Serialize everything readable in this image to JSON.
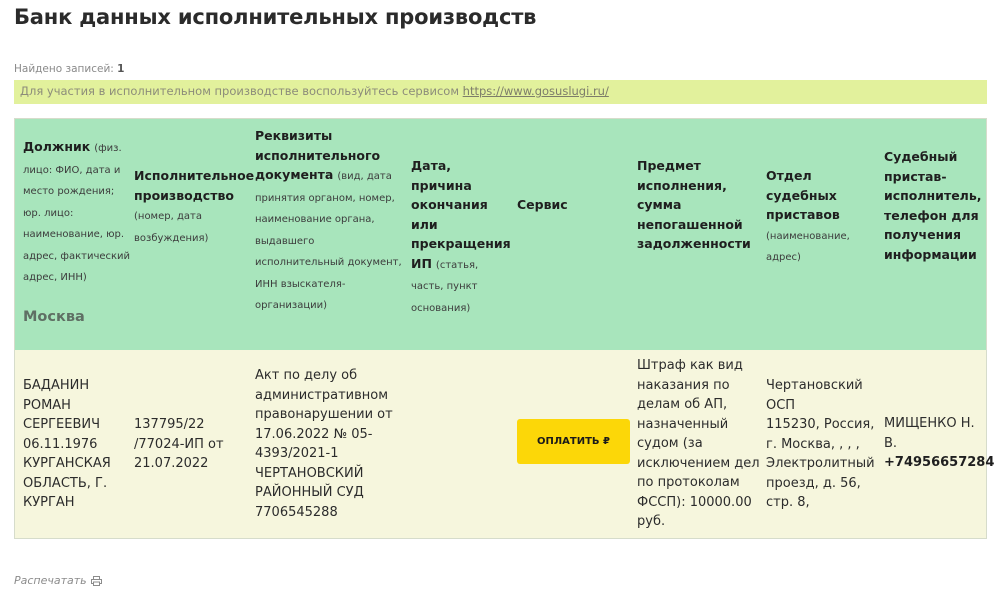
{
  "page": {
    "title": "Банк данных исполнительных производств"
  },
  "summary": {
    "found_label": "Найдено записей:",
    "found_count": "1"
  },
  "notice": {
    "text": "Для участия в исполнительном производстве воспользуйтесь сервисом",
    "link": "https://www.gosuslugi.ru/"
  },
  "table": {
    "columns": [
      {
        "title": "Должник",
        "sub": "(физ. лицо: ФИО, дата и место рождения; юр. лицо: наименование, юр. адрес, фактический адрес, ИНН)"
      },
      {
        "title": "Исполнительное производство",
        "sub": "(номер, дата возбуждения)"
      },
      {
        "title": "Реквизиты исполнительного документа",
        "sub": "(вид, дата принятия органом, номер, наименование органа, выдавшего исполнительный документ, ИНН взыскателя-организации)"
      },
      {
        "title": "Дата, причина окончания или прекращения ИП",
        "sub": "(статья, часть, пункт основания)"
      },
      {
        "title": "Сервис",
        "sub": ""
      },
      {
        "title": "Предмет исполнения, сумма непогашенной задолженности",
        "sub": ""
      },
      {
        "title": "Отдел судебных приставов",
        "sub": "(наименование, адрес)"
      },
      {
        "title": "Судебный пристав-исполнитель, телефон для получения информации",
        "sub": ""
      }
    ],
    "region": "Москва",
    "rows": [
      {
        "debtor": "БАДАНИН РОМАН СЕРГЕЕВИЧ 06.11.1976 КУРГАНСКАЯ ОБЛАСТЬ, Г. КУРГАН",
        "proceeding": "137795/22 /77024-ИП от 21.07.2022",
        "document": "Акт по делу об административном правонарушении от 17.06.2022 № 05-4393/2021-1 ЧЕРТАНОВСКИЙ РАЙОННЫЙ СУД 7706545288",
        "end_info": "",
        "service_button": "ОПЛАТИТЬ ₽",
        "subject": "Штраф как вид наказания по делам об АП, назначенный судом (за исключением дел по протоколам ФССП): 10000.00 руб.",
        "department_name": "Чертановский ОСП",
        "department_address": "115230, Россия, г. Москва, , , , Электролитный проезд, д. 56, стр. 8,",
        "bailiff": "МИЩЕНКО Н. В.",
        "phone": "+74956657284"
      }
    ]
  },
  "footer": {
    "print_label": "Распечатать",
    "print_icon": "printer-icon"
  },
  "colors": {
    "header_bg": "#a8e5bc",
    "row_bg": "#f6f6dd",
    "notice_bg": "#e2f19c",
    "pay_button": "#fcd708"
  }
}
